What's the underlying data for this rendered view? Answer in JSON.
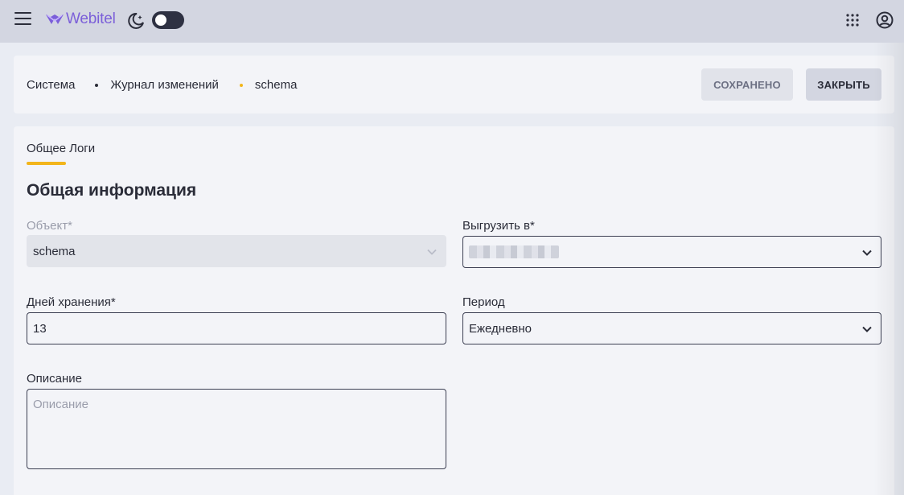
{
  "app": {
    "logo_text": "Webitel",
    "accent_color": "#f2b51b",
    "brand_color": "#7b5fd9"
  },
  "breadcrumb": {
    "items": [
      "Система",
      "Журнал изменений",
      "schema"
    ]
  },
  "header_actions": {
    "saved_label": "СОХРАНЕНО",
    "close_label": "ЗАКРЫТЬ"
  },
  "tabs": [
    {
      "label": "Общее",
      "active": true
    },
    {
      "label": "Логи",
      "active": false
    }
  ],
  "section": {
    "title": "Общая информация"
  },
  "form": {
    "object": {
      "label": "Объект*",
      "value": "schema",
      "disabled": true
    },
    "export_to": {
      "label": "Выгрузить в*",
      "value": ""
    },
    "retention_days": {
      "label": "Дней хранения*",
      "value": "13"
    },
    "period": {
      "label": "Период",
      "value": "Ежедневно"
    },
    "description": {
      "label": "Описание",
      "placeholder": "Описание",
      "value": ""
    }
  },
  "icons": {
    "menu": "hamburger-icon",
    "theme": "moon-icon",
    "apps": "apps-grid-icon",
    "account": "account-icon",
    "dropdown": "chevron-down-icon"
  }
}
